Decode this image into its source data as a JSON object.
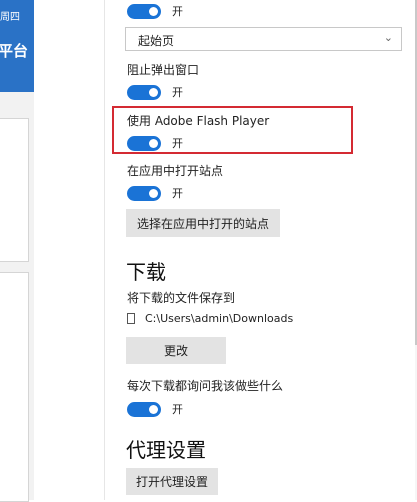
{
  "background_window": {
    "header_line1": "周四",
    "header_line2": "平台"
  },
  "settings": {
    "toggle_top": {
      "state": "开",
      "on": true
    },
    "startup_select": {
      "value": "起始页"
    },
    "popup_block": {
      "label": "阻止弹出窗口",
      "state": "开",
      "on": true
    },
    "flash": {
      "label": "使用 Adobe Flash Player",
      "state": "开",
      "on": true
    },
    "open_in_app": {
      "label": "在应用中打开站点",
      "state": "开",
      "on": true
    },
    "choose_sites_button": "选择在应用中打开的站点",
    "downloads": {
      "heading": "下载",
      "save_label": "将下载的文件保存到",
      "path": "C:\\Users\\admin\\Downloads",
      "change_button": "更改",
      "ask_label": "每次下载都询问我该做些什么",
      "ask_state": "开",
      "ask_on": true
    },
    "proxy": {
      "heading": "代理设置",
      "open_button": "打开代理设置"
    }
  },
  "colors": {
    "accent": "#1a73d6",
    "highlight": "#d42a32",
    "header_blue": "#2a72c6"
  }
}
